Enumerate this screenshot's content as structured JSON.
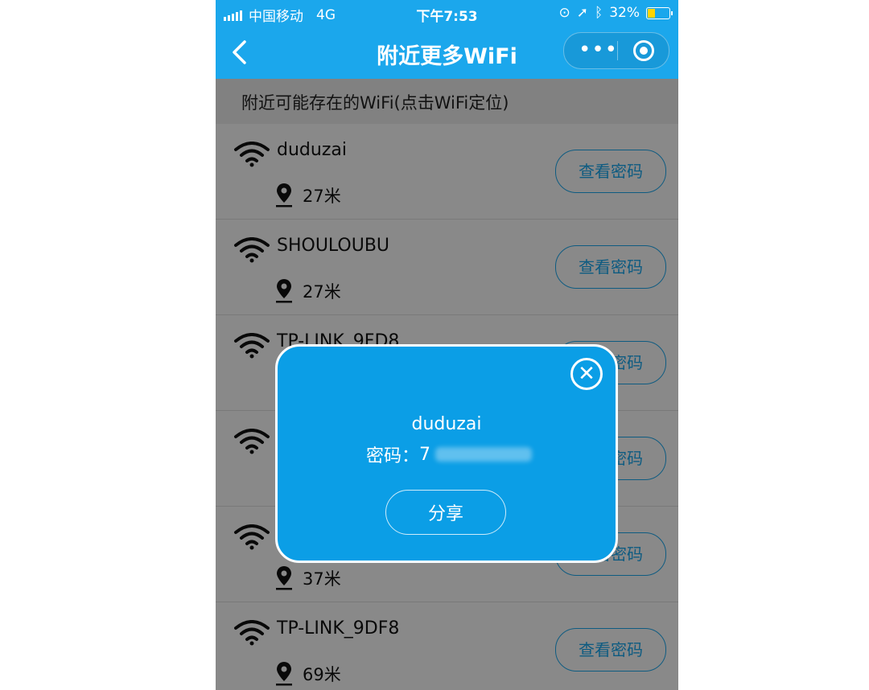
{
  "status_bar": {
    "carrier": "中国移动",
    "network": "4G",
    "time": "下午7:53",
    "battery": "32%",
    "battery_level": 0.32
  },
  "nav": {
    "title": "附近更多WiFi",
    "more_glyph": "•••"
  },
  "list_header": "附近可能存在的WiFi(点击WiFi定位)",
  "view_password_label": "查看密码",
  "wifi_list": [
    {
      "ssid": "duduzai",
      "distance": "27米"
    },
    {
      "ssid": "SHOULOUBU",
      "distance": "27米"
    },
    {
      "ssid": "TP-LINK_9FD8",
      "distance": ""
    },
    {
      "ssid": "",
      "distance": ""
    },
    {
      "ssid": "",
      "distance": "37米"
    },
    {
      "ssid": "TP-LINK_9DF8",
      "distance": "69米"
    }
  ],
  "modal": {
    "ssid": "duduzai",
    "password_label": "密码：",
    "password_visible": "7",
    "share_label": "分享"
  },
  "colors": {
    "brand_blue": "#1ba7ec",
    "modal_blue": "#0b9ee6",
    "battery_yellow": "#ffd400"
  },
  "icons": {
    "back": "chevron-left-icon",
    "wifi": "wifi-icon",
    "location": "location-pin-icon",
    "close": "close-icon"
  }
}
